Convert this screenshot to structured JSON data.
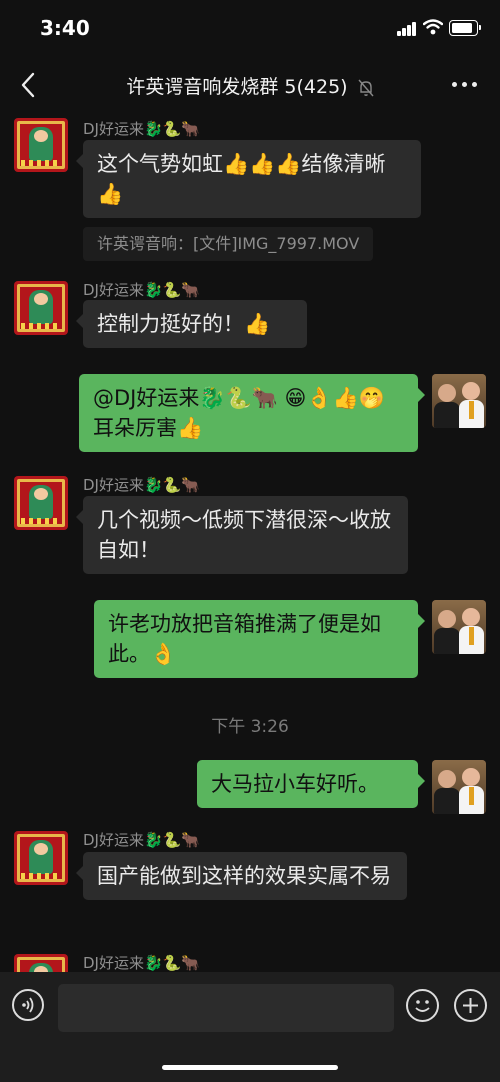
{
  "status": {
    "time": "3:40"
  },
  "nav": {
    "title": "许英谔音响发烧群 5(425)"
  },
  "messages": [
    {
      "sender": "DJ好运来🐉🐍🐂",
      "text": "这个气势如虹👍👍👍结像清晰👍"
    },
    {
      "quote": "许英谔音响：[文件]IMG_7997.MOV"
    },
    {
      "sender": "DJ好运来🐉🐍🐂",
      "text": "控制力挺好的！👍"
    },
    {
      "text": "@DJ好运来🐉🐍🐂 😁👌👍🤭耳朵厉害👍"
    },
    {
      "sender": "DJ好运来🐉🐍🐂",
      "text": "几个视频～低频下潜很深～收放自如！"
    },
    {
      "text": "许老功放把音箱推满了便是如此。👌"
    },
    {
      "text": "大马拉小车好听。"
    },
    {
      "sender": "DJ好运来🐉🐍🐂",
      "text": "国产能做到这样的效果实属不易"
    },
    {
      "sender": "DJ好运来🐉🐍🐂"
    }
  ],
  "timestamp": "下午 3:26",
  "icons": {
    "back": "chevron-left-icon",
    "mute": "bell-muted-icon",
    "more": "more-dots-icon",
    "voice": "voice-icon",
    "emoji": "emoji-icon",
    "plus": "plus-icon"
  },
  "colors": {
    "background": "#111111",
    "incoming_bubble": "#2c2c2c",
    "outgoing_bubble": "#5ab55e"
  }
}
